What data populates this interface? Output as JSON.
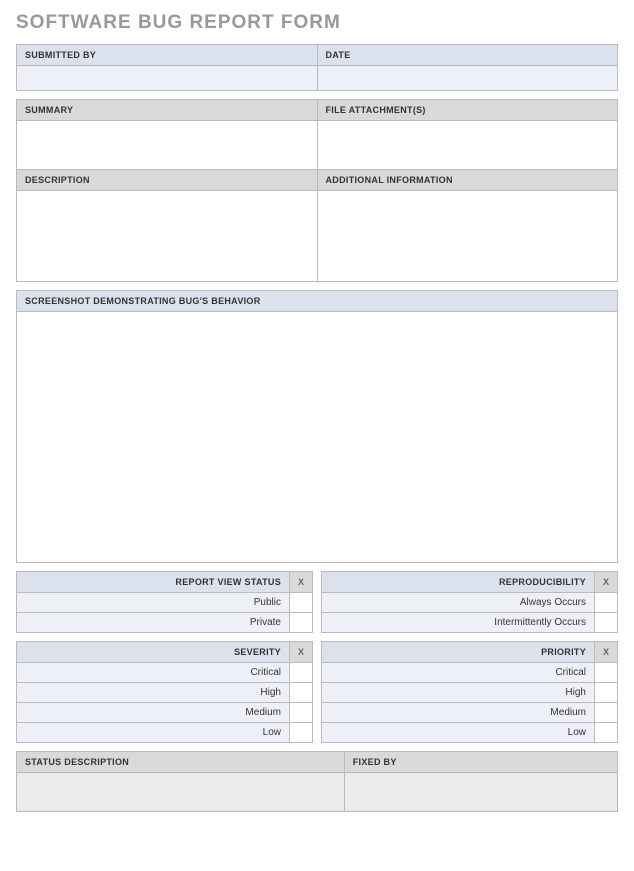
{
  "title": "SOFTWARE BUG REPORT FORM",
  "top": {
    "submitted_by_label": "SUBMITTED BY",
    "submitted_by_value": "",
    "date_label": "DATE",
    "date_value": ""
  },
  "main": {
    "summary_label": "SUMMARY",
    "summary_value": "",
    "file_attach_label": "FILE ATTACHMENT(S)",
    "file_attach_value": "",
    "description_label": "DESCRIPTION",
    "description_value": "",
    "addl_info_label": "ADDITIONAL INFORMATION",
    "addl_info_value": ""
  },
  "screenshot_label": "SCREENSHOT DEMONSTRATING BUG'S BEHAVIOR",
  "screenshot_value": "",
  "checks": {
    "x_marker": "X",
    "group1": {
      "left": {
        "header": "REPORT VIEW STATUS",
        "items": [
          "Public",
          "Private"
        ]
      },
      "right": {
        "header": "REPRODUCIBILITY",
        "items": [
          "Always Occurs",
          "Intermittently Occurs"
        ]
      }
    },
    "group2": {
      "left": {
        "header": "SEVERITY",
        "items": [
          "Critical",
          "High",
          "Medium",
          "Low"
        ]
      },
      "right": {
        "header": "PRIORITY",
        "items": [
          "Critical",
          "High",
          "Medium",
          "Low"
        ]
      }
    }
  },
  "status": {
    "desc_label": "STATUS DESCRIPTION",
    "desc_value": "",
    "fixed_by_label": "FIXED BY",
    "fixed_by_value": ""
  }
}
